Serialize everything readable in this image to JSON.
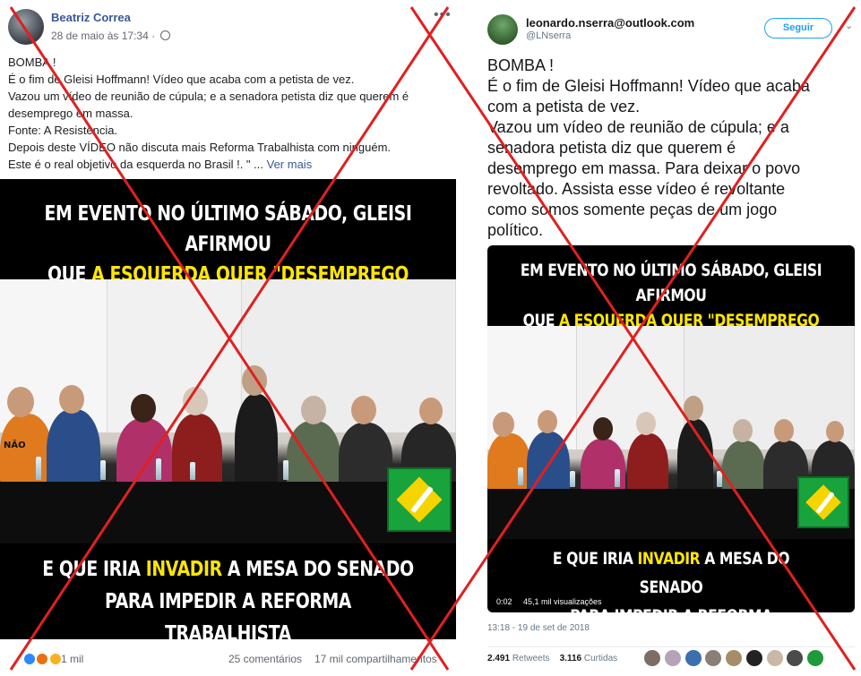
{
  "facebook": {
    "author": "Beatriz Correa",
    "timestamp": "28 de maio às 17:34",
    "more_icon": "more-horizontal-icon",
    "text_lines": [
      "BOMBA !",
      "É o fim de Gleisi Hoffmann! Vídeo que acaba com a petista de vez.",
      "Vazou um vídeo de reunião de cúpula; e a senadora petista diz que querem é",
      "desemprego em massa.",
      "Fonte: A Resistência.",
      "Depois deste VÍDEO não discuta mais Reforma Trabalhista com ninguém.",
      "Este é o real objetivo da esquerda no Brasil !. \" ..."
    ],
    "see_more": "Ver mais",
    "reactions_count": "1 mil",
    "comments": "25 comentários",
    "shares": "17 mil compartilhamentos"
  },
  "twitter": {
    "author": "leonardo.nserra@outlook.com",
    "handle": "@LNserra",
    "follow_label": "Seguir",
    "text_lines": [
      "BOMBA !",
      "É o fim de Gleisi Hoffmann! Vídeo que acaba",
      "com a petista de vez.",
      "Vazou um vídeo de reunião de cúpula; e a",
      "senadora petista diz que querem é",
      "desemprego em massa. Para deixar o povo",
      "revoltado. Assista esse vídeo é revoltante",
      "como somos somente peças de um jogo",
      "político."
    ],
    "video_time": "0:02",
    "video_views": "45,1 mil visualizações",
    "timestamp": "13:18 - 19 de set de 2018",
    "retweets_count": "2.491",
    "retweets_label": "Retweets",
    "likes_count": "3.116",
    "likes_label": "Curtidas"
  },
  "video_caption": {
    "top_line1": "EM EVENTO NO ÚLTIMO SÁBADO, GLEISI AFIRMOU",
    "top_line2_a": "QUE ",
    "top_line2_b": "A ESQUERDA QUER \"DESEMPREGO EFETIVO\"",
    "bottom_line1_a": "E QUE IRIA ",
    "bottom_line1_b": "INVADIR",
    "bottom_line1_c": " A MESA DO SENADO",
    "bottom_line2": "PARA IMPEDIR A REFORMA TRABALHISTA",
    "shirt_text": "NÃO"
  },
  "colors": {
    "facebook_link": "#385898",
    "twitter_blue": "#1da1f2",
    "caption_yellow": "#ffe600",
    "x_red": "#e02020"
  }
}
